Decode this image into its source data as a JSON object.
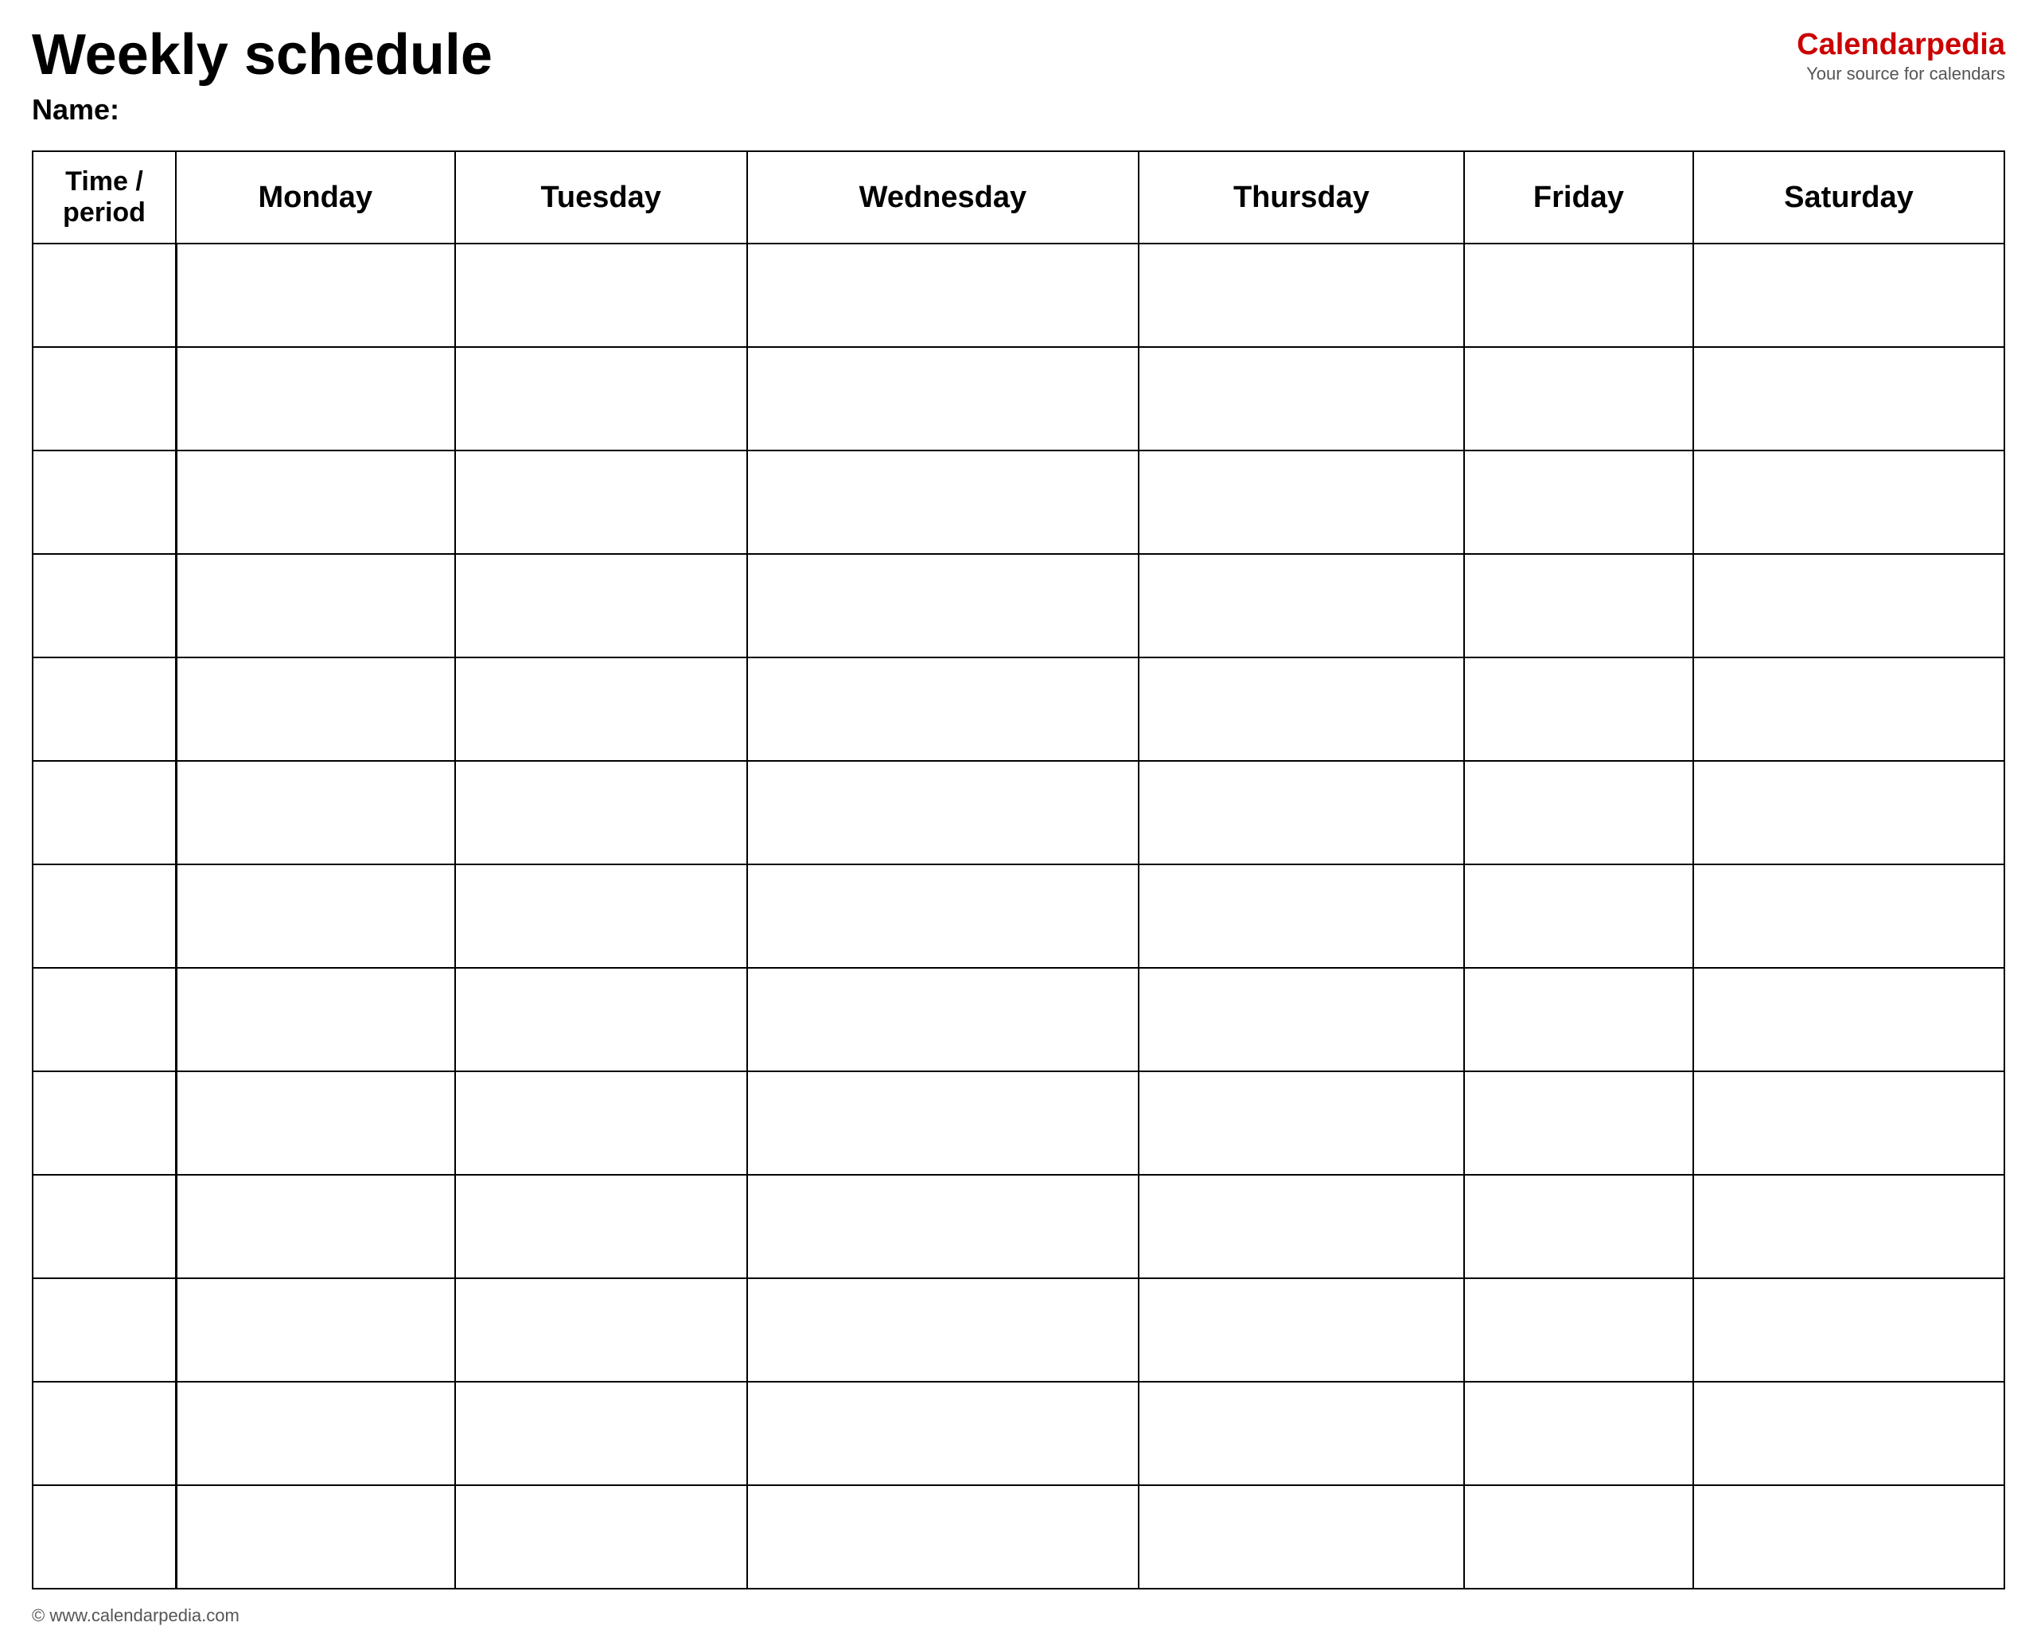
{
  "header": {
    "title": "Weekly schedule",
    "name_label": "Name:",
    "logo": {
      "text_black": "Calendar",
      "text_red": "pedia",
      "tagline": "Your source for calendars"
    }
  },
  "table": {
    "columns": [
      "Time / period",
      "Monday",
      "Tuesday",
      "Wednesday",
      "Thursday",
      "Friday",
      "Saturday"
    ],
    "row_count": 13
  },
  "footer": {
    "url": "© www.calendarpedia.com"
  }
}
